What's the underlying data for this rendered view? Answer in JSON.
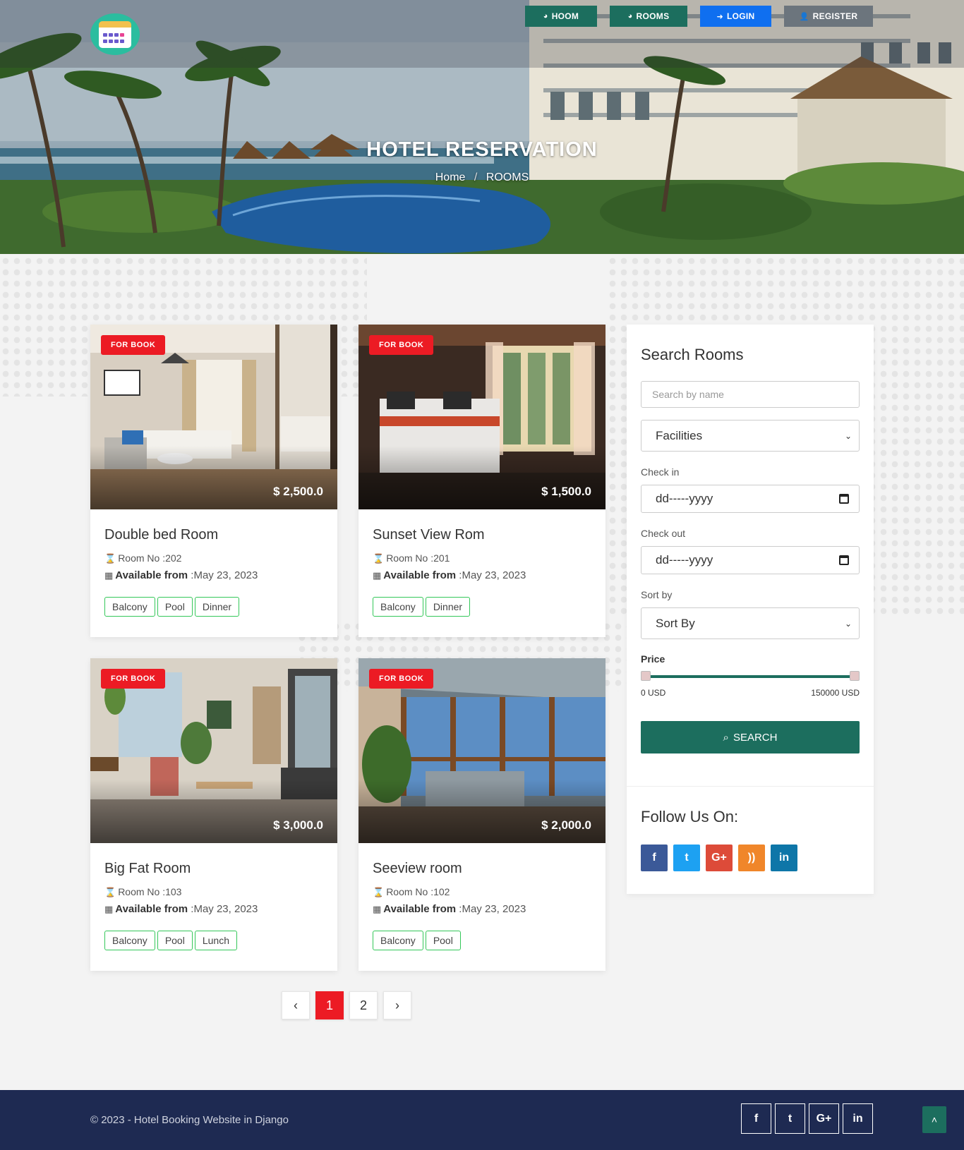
{
  "header": {
    "nav": [
      {
        "label": "HOOM",
        "icon": "dashboard-icon"
      },
      {
        "label": "ROOMS",
        "icon": "dashboard-icon"
      },
      {
        "label": "LOGIN",
        "icon": "sign-in-icon"
      },
      {
        "label": "REGISTER",
        "icon": "user-plus-icon"
      }
    ],
    "title": "HOTEL RESERVATION",
    "breadcrumb": {
      "home": "Home",
      "separator": "/",
      "current": "ROOMS"
    }
  },
  "rooms": [
    {
      "badge": "FOR BOOK",
      "price": "$ 2,500.0",
      "name": "Double bed Room",
      "room_no_label": "Room No :",
      "room_no": "202",
      "available_label": "Available from",
      "available_from": ":May 23, 2023",
      "tags": [
        "Balcony",
        "Pool",
        "Dinner"
      ]
    },
    {
      "badge": "FOR BOOK",
      "price": "$ 1,500.0",
      "name": "Sunset View Rom",
      "room_no_label": "Room No :",
      "room_no": "201",
      "available_label": "Available from",
      "available_from": ":May 23, 2023",
      "tags": [
        "Balcony",
        "Dinner"
      ]
    },
    {
      "badge": "FOR BOOK",
      "price": "$ 3,000.0",
      "name": "Big Fat Room",
      "room_no_label": "Room No :",
      "room_no": "103",
      "available_label": "Available from",
      "available_from": ":May 23, 2023",
      "tags": [
        "Balcony",
        "Pool",
        "Lunch"
      ]
    },
    {
      "badge": "FOR BOOK",
      "price": "$ 2,000.0",
      "name": "Seeview room",
      "room_no_label": "Room No :",
      "room_no": "102",
      "available_label": "Available from",
      "available_from": ":May 23, 2023",
      "tags": [
        "Balcony",
        "Pool"
      ]
    }
  ],
  "search": {
    "title": "Search Rooms",
    "name_placeholder": "Search by name",
    "facilities": "Facilities",
    "checkin_label": "Check in",
    "checkin_value": "dd-----yyyy",
    "checkout_label": "Check out",
    "checkout_value": "dd-----yyyy",
    "sort_label": "Sort by",
    "sort_value": "Sort By",
    "price_label": "Price",
    "price_min": "0 USD",
    "price_max": "150000 USD",
    "price_range_fraction": [
      0,
      1
    ],
    "button": "SEARCH"
  },
  "follow": {
    "title": "Follow Us On:",
    "networks": [
      {
        "icon": "facebook-icon",
        "glyph": "f",
        "color": "#3b5998"
      },
      {
        "icon": "twitter-icon",
        "glyph": "t",
        "color": "#1da1f2"
      },
      {
        "icon": "google-plus-icon",
        "glyph": "G+",
        "color": "#dd4b39"
      },
      {
        "icon": "rss-icon",
        "glyph": "))",
        "color": "#f0862a"
      },
      {
        "icon": "linkedin-icon",
        "glyph": "in",
        "color": "#0e76a8"
      }
    ]
  },
  "pagination": {
    "prev": "‹",
    "pages": [
      "1",
      "2"
    ],
    "active": "1",
    "next": "›"
  },
  "footer": {
    "copyright": "© 2023 - Hotel Booking Website in Django",
    "social": [
      {
        "icon": "facebook-icon",
        "glyph": "f"
      },
      {
        "icon": "twitter-icon",
        "glyph": "t"
      },
      {
        "icon": "google-plus-icon",
        "glyph": "G+"
      },
      {
        "icon": "linkedin-icon",
        "glyph": "in"
      }
    ],
    "to_top": "˄"
  }
}
